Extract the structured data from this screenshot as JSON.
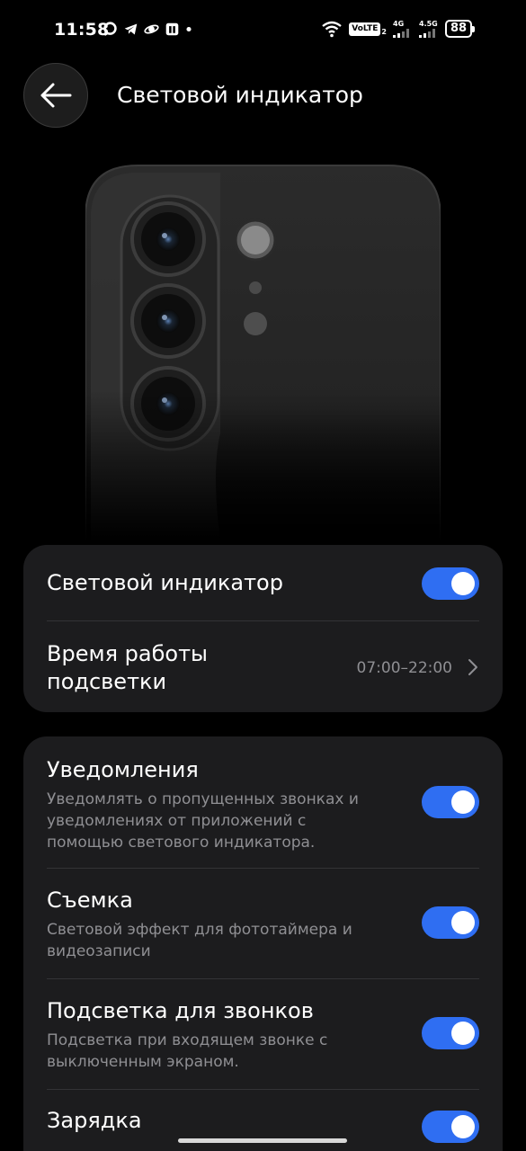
{
  "status_bar": {
    "time": "11:58",
    "left_icons": [
      "chat-icon",
      "telegram-icon",
      "planet-icon",
      "app-icon",
      "dot-icon"
    ],
    "volte": "VoLTE",
    "sim_index": "2",
    "network_1": "4G",
    "network_2": "4.5G",
    "battery": "88"
  },
  "header": {
    "title": "Световой индикатор",
    "back_icon": "arrow-left-icon"
  },
  "card1": {
    "indicator_toggle": {
      "title": "Световой индикатор",
      "enabled": true
    },
    "working_time": {
      "title": "Время работы подсветки",
      "value": "07:00–22:00",
      "icon": "chevron-right-icon"
    }
  },
  "card2": {
    "items": [
      {
        "title": "Уведомления",
        "description": "Уведомлять о пропущенных звонках и уведомлениях от приложений с помощью светового индикатора.",
        "enabled": true
      },
      {
        "title": "Съемка",
        "description": "Световой эффект для фототаймера и видеозаписи",
        "enabled": true
      },
      {
        "title": "Подсветка для звонков",
        "description": "Подсветка при входящем звонке с выключенным экраном.",
        "enabled": true
      },
      {
        "title": "Зарядка",
        "description": "",
        "enabled": true
      }
    ]
  },
  "colors": {
    "accent": "#2f6ef2",
    "card_bg": "#1c1c1e",
    "secondary_text": "#8f8f93"
  }
}
